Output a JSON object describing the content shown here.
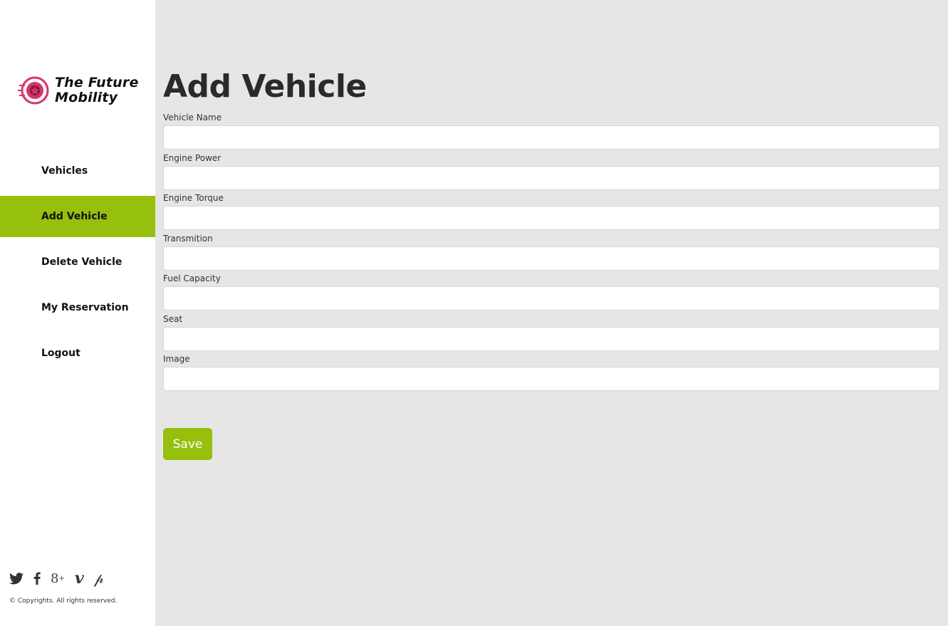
{
  "brand": {
    "name_line1": "The Future",
    "name_line2": "Mobility",
    "logo_color": "#d6336c"
  },
  "sidebar": {
    "items": [
      {
        "label": "Vehicles",
        "active": false
      },
      {
        "label": "Add Vehicle",
        "active": true
      },
      {
        "label": "Delete Vehicle",
        "active": false
      },
      {
        "label": "My Reservation",
        "active": false
      },
      {
        "label": "Logout",
        "active": false
      }
    ],
    "social": [
      "twitter-icon",
      "facebook-icon",
      "google-plus-icon",
      "vimeo-icon",
      "pinterest-icon"
    ],
    "copyright": "© Copyrights. All rights reserved."
  },
  "main": {
    "title": "Add Vehicle",
    "fields": [
      {
        "label": "Vehicle Name",
        "value": ""
      },
      {
        "label": "Engine Power",
        "value": ""
      },
      {
        "label": "Engine Torque",
        "value": ""
      },
      {
        "label": "Transmition",
        "value": ""
      },
      {
        "label": "Fuel Capacity",
        "value": ""
      },
      {
        "label": "Seat",
        "value": ""
      },
      {
        "label": "Image",
        "value": ""
      }
    ],
    "save_label": "Save"
  },
  "colors": {
    "accent": "#97bf0d",
    "background": "#e6e6e6",
    "sidebar": "#ffffff"
  }
}
